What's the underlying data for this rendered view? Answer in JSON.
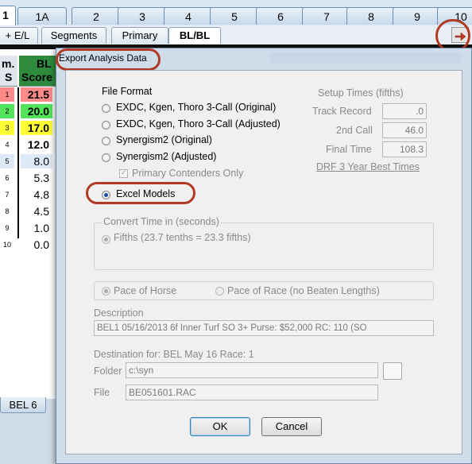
{
  "race_tabs": [
    "1",
    "1A",
    "2",
    "3",
    "4",
    "5",
    "6",
    "7",
    "8",
    "9",
    "10"
  ],
  "sub_tabs": [
    "+ E/L",
    "Segments",
    "Primary",
    "BL/BL"
  ],
  "left_grid": {
    "header_col1_line1": "m.",
    "header_col1_line2": "S",
    "header_col2_line1": "BL",
    "header_col2_line2": "Score",
    "rows": [
      {
        "num": "1",
        "score": "21.5",
        "color": "#ff8a8a"
      },
      {
        "num": "2",
        "score": "20.0",
        "color": "#53e35a"
      },
      {
        "num": "3",
        "score": "17.0",
        "color": "#ffff33"
      },
      {
        "num": "4",
        "score": "12.0",
        "color": "#ffffff"
      },
      {
        "num": "5",
        "score": "8.0",
        "color": "#dde9f6"
      },
      {
        "num": "6",
        "score": "5.3",
        "color": "#ffffff"
      },
      {
        "num": "7",
        "score": "4.8",
        "color": "#ffffff"
      },
      {
        "num": "8",
        "score": "4.5",
        "color": "#ffffff"
      },
      {
        "num": "9",
        "score": "1.0",
        "color": "#ffffff"
      },
      {
        "num": "10",
        "score": "0.0",
        "color": "#ffffff"
      }
    ],
    "bottom_tab": "BEL 6"
  },
  "dialog": {
    "title": "Export Analysis Data",
    "file_format": {
      "heading": "File Format",
      "options": [
        "EXDC, Kgen, Thoro 3-Call (Original)",
        "EXDC, Kgen, Thoro 3-Call (Adjusted)",
        "Synergism2 (Original)",
        "Synergism2 (Adjusted)"
      ],
      "checkbox_label": "Primary Contenders Only",
      "selected_label": "Excel Models"
    },
    "setup_times": {
      "heading": "Setup Times (fifths)",
      "track_record_label": "Track Record",
      "track_record_value": ".0",
      "second_call_label": "2nd Call",
      "second_call_value": "46.0",
      "final_time_label": "Final Time",
      "final_time_value": "108.3",
      "link": "DRF 3 Year Best Times"
    },
    "convert_time": {
      "heading": "Convert Time in (seconds)",
      "option": "Fifths (23.7 tenths = 23.3 fifths)"
    },
    "pace": {
      "horse": "Pace of Horse",
      "race": "Pace of Race (no Beaten Lengths)"
    },
    "description": {
      "label": "Description",
      "value": "BEL1  05/16/2013  6f  Inner Turf  SO  3+   Purse: $52,000   RC: 110  (SO"
    },
    "destination": {
      "label": "Destination for: BEL May 16  Race: 1",
      "folder_label": "Folder",
      "folder_value": "c:\\syn",
      "file_label": "File",
      "file_value": "BE051601.RAC"
    },
    "ok": "OK",
    "cancel": "Cancel"
  },
  "colors": {
    "highlight_ring": "#b03a24",
    "dialog_frame": "#cfdcea"
  }
}
